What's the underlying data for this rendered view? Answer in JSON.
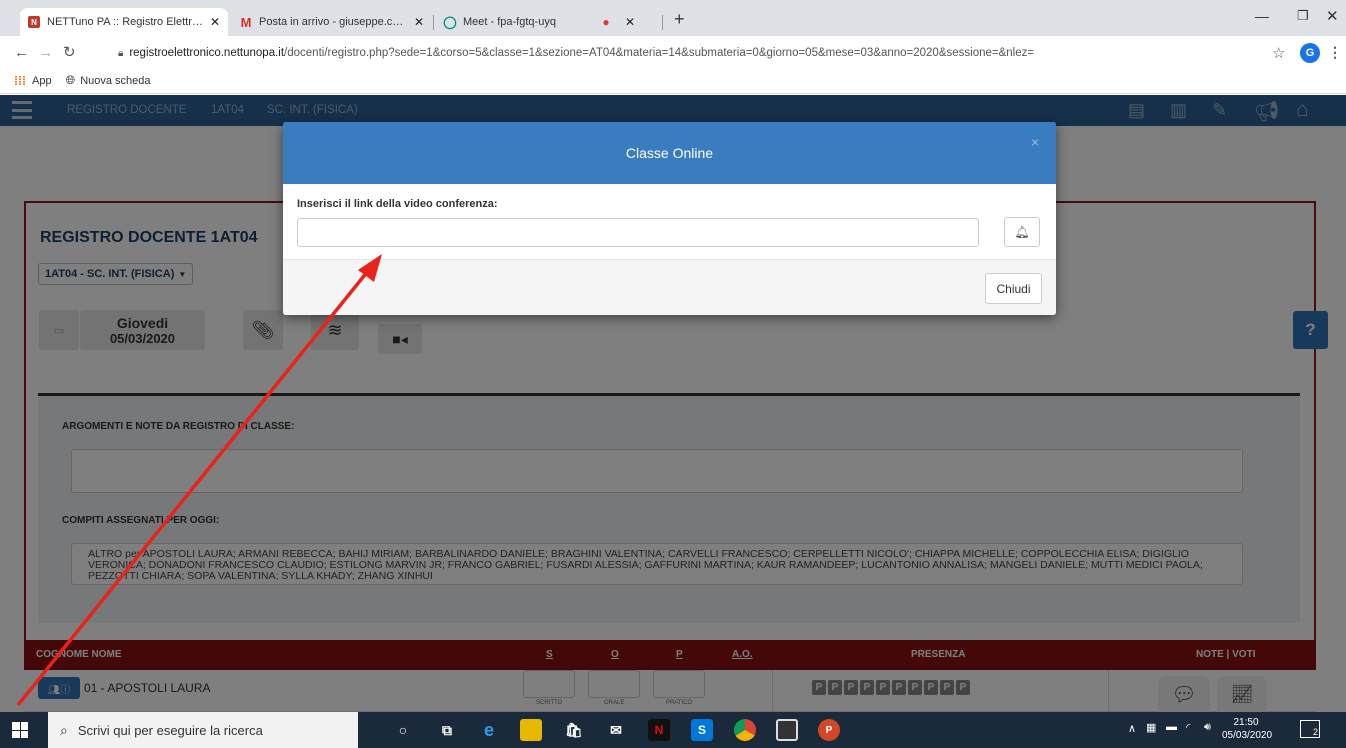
{
  "browser": {
    "tabs": [
      {
        "title": "NETTuno PA :: Registro Elettronic",
        "icon": "nettuno-icon",
        "active": true
      },
      {
        "title": "Posta in arrivo - giuseppe.chisena",
        "icon": "gmail-icon",
        "active": false
      },
      {
        "title": "Meet - fpa-fgtq-uyq",
        "icon": "meet-icon",
        "active": false
      },
      {
        "title": "",
        "icon": "recording-dot-icon",
        "active": false
      }
    ],
    "url_host": "registroelettronico.nettunopa.it",
    "url_path": "/docenti/registro.php?sede=1&corso=5&classe=1&sezione=AT04&materia=14&submateria=0&giorno=05&mese=03&anno=2020&sessione=&nlez=",
    "profile_initial": "G",
    "bookmarks": [
      "App",
      "Nuova scheda"
    ]
  },
  "app": {
    "nav": [
      "REGISTRO DOCENTE",
      "1AT04",
      "SC. INT. (FISICA)"
    ],
    "title": "REGISTRO DOCENTE 1AT04",
    "class_select": "1AT04 - SC. INT. (FISICA)",
    "day_name": "Giovedi",
    "date": "05/03/2020",
    "help": "?",
    "args_label": "ARGOMENTI E NOTE DA REGISTRO DI CLASSE:",
    "homework_label": "COMPITI ASSEGNATI PER OGGI:",
    "homework_text": "ALTRO per  APOSTOLI LAURA; ARMANI REBECCA; BAHIJ MIRIAM; BARBALINARDO DANIELE; BRAGHINI VALENTINA; CARVELLI FRANCESCO; CERPELLETTI NICOLO'; CHIAPPA MICHELLE; COPPOLECCHIA ELISA; DIGIGLIO VERONICA; DONADONI FRANCESCO CLAUDIO; ESTILONG MARVIN JR; FRANCO GABRIEL; FUSARDI ALESSIA; GAFFURINI MARTINA; KAUR RAMANDEEP; LUCANTONIO ANNALISA; MANGELI DANIELE; MUTTI MEDICI PAOLA; PEZZOTTI CHIARA; SOPA VALENTINA; SYLLA KHADY; ZHANG XINHUI",
    "table_headers": {
      "name": "COGNOME NOME",
      "s": "S",
      "o": "O",
      "p": "P",
      "ao": "A.O.",
      "presence": "PRESENZA",
      "notes": "NOTE | VOTI"
    },
    "student": {
      "name": "01 - APOSTOLI LAURA",
      "scritto": "SCRITTO",
      "orale": "ORALE",
      "pratico": "PRATICO",
      "presence_marks": [
        "P",
        "P",
        "P",
        "P",
        "P",
        "P",
        "P",
        "P",
        "P",
        "P"
      ]
    }
  },
  "modal": {
    "title": "Classe Online",
    "close": "×",
    "label": "Inserisci il link della video conferenza:",
    "input_value": "",
    "close_button": "Chiudi"
  },
  "taskbar": {
    "search_placeholder": "Scrivi qui per eseguire la ricerca",
    "time": "21:50",
    "date": "05/03/2020",
    "notification_count": "2"
  },
  "colors": {
    "nav": "#2c6196",
    "modal_header": "#3a7cc0",
    "table_header": "#8b1111",
    "annotation_arrow": "#e8231b"
  }
}
